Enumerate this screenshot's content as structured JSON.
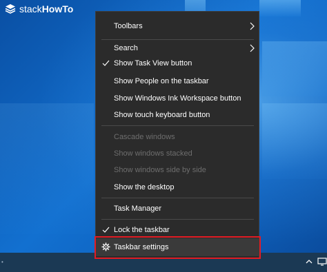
{
  "logo": {
    "brand_light": "stack",
    "brand_bold": "HowTo"
  },
  "menu": {
    "items": [
      {
        "label": "Toolbars",
        "enabled": true,
        "checked": false,
        "submenu": true
      },
      {
        "label": "Search",
        "enabled": true,
        "checked": false,
        "submenu": true
      },
      {
        "label": "Show Task View button",
        "enabled": true,
        "checked": true,
        "submenu": false
      },
      {
        "label": "Show People on the taskbar",
        "enabled": true,
        "checked": false,
        "submenu": false
      },
      {
        "label": "Show Windows Ink Workspace button",
        "enabled": true,
        "checked": false,
        "submenu": false
      },
      {
        "label": "Show touch keyboard button",
        "enabled": true,
        "checked": false,
        "submenu": false
      },
      {
        "label": "Cascade windows",
        "enabled": false,
        "checked": false,
        "submenu": false
      },
      {
        "label": "Show windows stacked",
        "enabled": false,
        "checked": false,
        "submenu": false
      },
      {
        "label": "Show windows side by side",
        "enabled": false,
        "checked": false,
        "submenu": false
      },
      {
        "label": "Show the desktop",
        "enabled": true,
        "checked": false,
        "submenu": false
      },
      {
        "label": "Task Manager",
        "enabled": true,
        "checked": false,
        "submenu": false
      },
      {
        "label": "Lock the taskbar",
        "enabled": true,
        "checked": true,
        "submenu": false
      },
      {
        "label": "Taskbar settings",
        "enabled": true,
        "checked": false,
        "submenu": false,
        "icon": "gear-icon",
        "highlighted": true
      }
    ]
  },
  "colors": {
    "menu_bg": "#2b2b2b",
    "menu_text": "#ffffff",
    "disabled_text": "#6e6e6e",
    "highlight_outline": "#e31b23",
    "taskbar": "#1b3954"
  }
}
